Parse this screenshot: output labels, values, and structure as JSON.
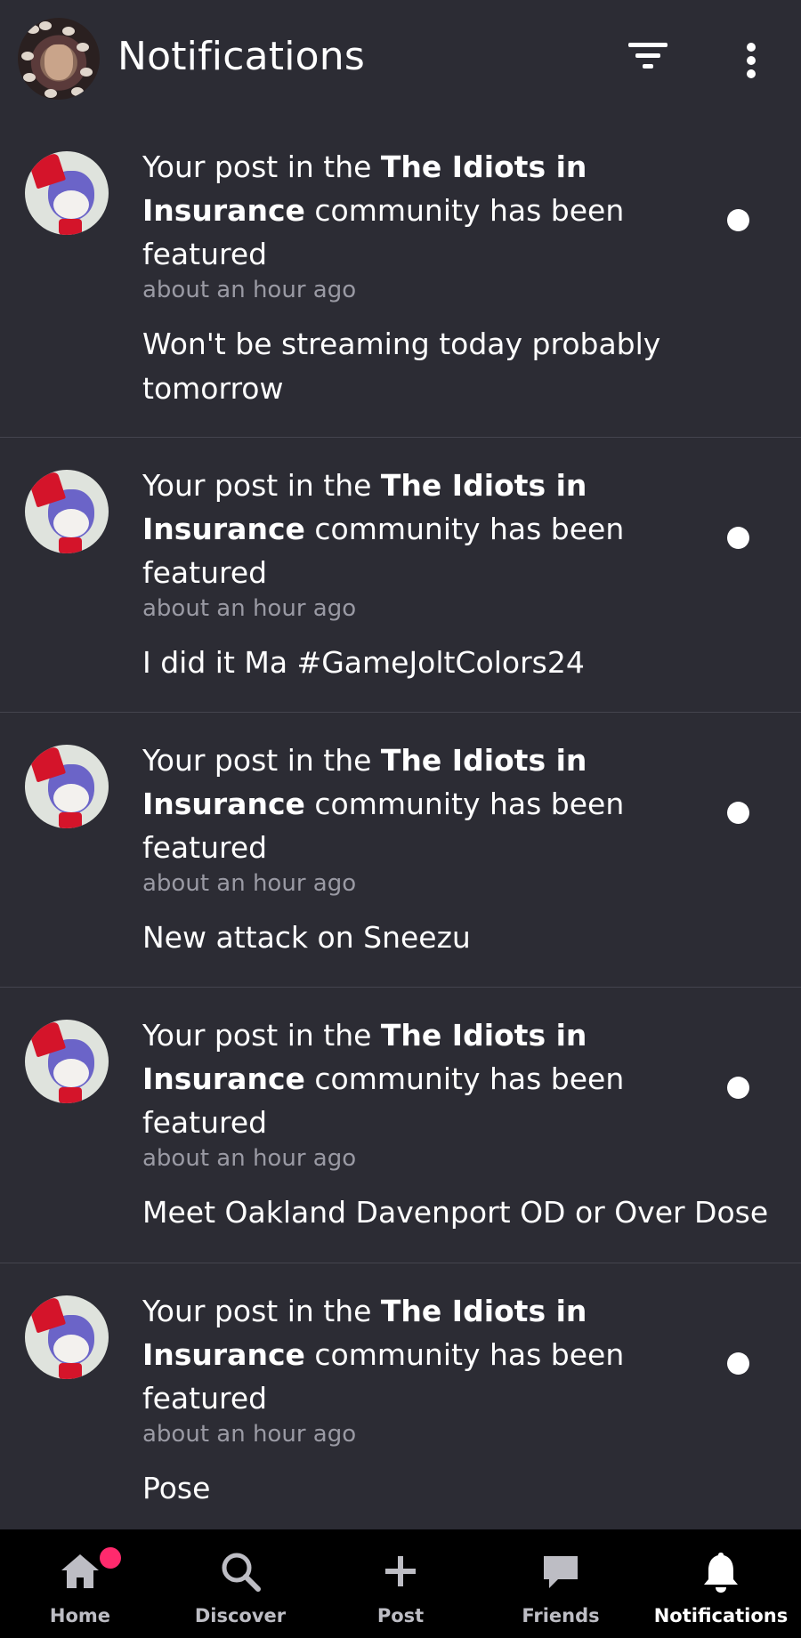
{
  "header": {
    "title": "Notifications"
  },
  "notifications": [
    {
      "headline_prefix": "Your post in the ",
      "community": "The Idiots in Insurance",
      "headline_suffix": " community has been featured",
      "time": "about an hour ago",
      "excerpt": "Won't be streaming today probably tomorrow"
    },
    {
      "headline_prefix": "Your post in the ",
      "community": "The Idiots in Insurance",
      "headline_suffix": " community has been featured",
      "time": "about an hour ago",
      "excerpt": "I did it Ma #GameJoltColors24"
    },
    {
      "headline_prefix": "Your post in the ",
      "community": "The Idiots in Insurance",
      "headline_suffix": " community has been featured",
      "time": "about an hour ago",
      "excerpt": "New attack on Sneezu"
    },
    {
      "headline_prefix": "Your post in the ",
      "community": "The Idiots in Insurance",
      "headline_suffix": " community has been featured",
      "time": "about an hour ago",
      "excerpt": "Meet Oakland Davenport OD or Over Dose"
    },
    {
      "headline_prefix": "Your post in the ",
      "community": "The Idiots in Insurance",
      "headline_suffix": " community has been featured",
      "time": "about an hour ago",
      "excerpt": "Pose"
    }
  ],
  "nav": {
    "home": "Home",
    "discover": "Discover",
    "post": "Post",
    "friends": "Friends",
    "notifications": "Notifications"
  },
  "colors": {
    "background": "#2c2c34",
    "nav_background": "#000000",
    "badge": "#ff2a6d",
    "muted_text": "#9a9aa4"
  }
}
